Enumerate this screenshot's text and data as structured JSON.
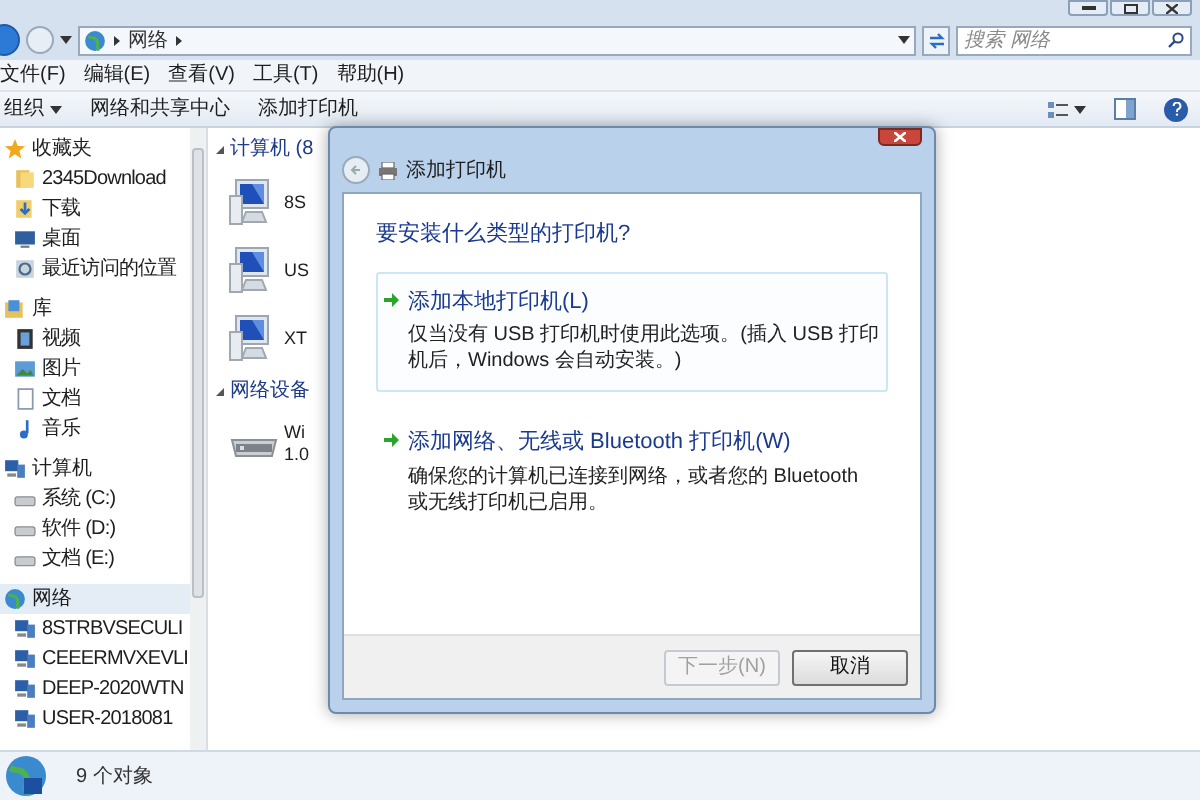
{
  "address_bar": {
    "path": [
      "网络"
    ],
    "search": {
      "placeholder": "搜索 网络"
    }
  },
  "menu_bar": [
    "文件(F)",
    "编辑(E)",
    "查看(V)",
    "工具(T)",
    "帮助(H)"
  ],
  "toolbar": [
    {
      "label": "组织",
      "dropdown": true
    },
    {
      "label": "网络和共享中心",
      "dropdown": false
    },
    {
      "label": "添加打印机",
      "dropdown": false
    }
  ],
  "sidebar": [
    {
      "label": "收藏夹",
      "kind": "star",
      "selected": false,
      "children": [
        {
          "label": "2345Download",
          "kind": "folder"
        },
        {
          "label": "下载",
          "kind": "download"
        },
        {
          "label": "桌面",
          "kind": "desktop"
        },
        {
          "label": "最近访问的位置",
          "kind": "recent"
        }
      ]
    },
    {
      "label": "库",
      "kind": "library",
      "selected": false,
      "children": [
        {
          "label": "视频",
          "kind": "video"
        },
        {
          "label": "图片",
          "kind": "picture"
        },
        {
          "label": "文档",
          "kind": "document"
        },
        {
          "label": "音乐",
          "kind": "music"
        }
      ]
    },
    {
      "label": "计算机",
      "kind": "computer",
      "selected": false,
      "children": [
        {
          "label": "系统 (C:)",
          "kind": "drive"
        },
        {
          "label": "软件 (D:)",
          "kind": "drive"
        },
        {
          "label": "文档 (E:)",
          "kind": "drive"
        }
      ]
    },
    {
      "label": "网络",
      "kind": "network",
      "selected": true,
      "children": [
        {
          "label": "8STRBVSECULI",
          "kind": "computer"
        },
        {
          "label": "CEEERMVXEVLI",
          "kind": "computer"
        },
        {
          "label": "DEEP-2020WTN",
          "kind": "computer"
        },
        {
          "label": "USER-2018081",
          "kind": "computer"
        }
      ]
    }
  ],
  "content": [
    {
      "title": "计算机 (8",
      "items": [
        {
          "kind": "computer",
          "lines": [
            "8S"
          ]
        },
        {
          "kind": "computer",
          "lines": [
            "US"
          ]
        },
        {
          "kind": "computer",
          "lines": [
            "XT"
          ]
        }
      ]
    },
    {
      "title": "网络设备",
      "items": [
        {
          "kind": "router",
          "lines": [
            "Wi",
            "1.0"
          ]
        }
      ]
    }
  ],
  "status_bar": {
    "text": "9 个对象"
  },
  "dialog": {
    "title": "添加打印机",
    "heading": "要安装什么类型的打印机?",
    "options": [
      {
        "title": "添加本地打印机(L)",
        "description": "仅当没有 USB 打印机时使用此选项。(插入 USB 打印机后，Windows 会自动安装。)",
        "selected": true
      },
      {
        "title": "添加网络、无线或 Bluetooth 打印机(W)",
        "description": "确保您的计算机已连接到网络，或者您的 Bluetooth 或无线打印机已启用。",
        "selected": false
      }
    ],
    "buttons": [
      {
        "label": "下一步(N)",
        "disabled": true
      },
      {
        "label": "取消",
        "disabled": false
      }
    ]
  }
}
